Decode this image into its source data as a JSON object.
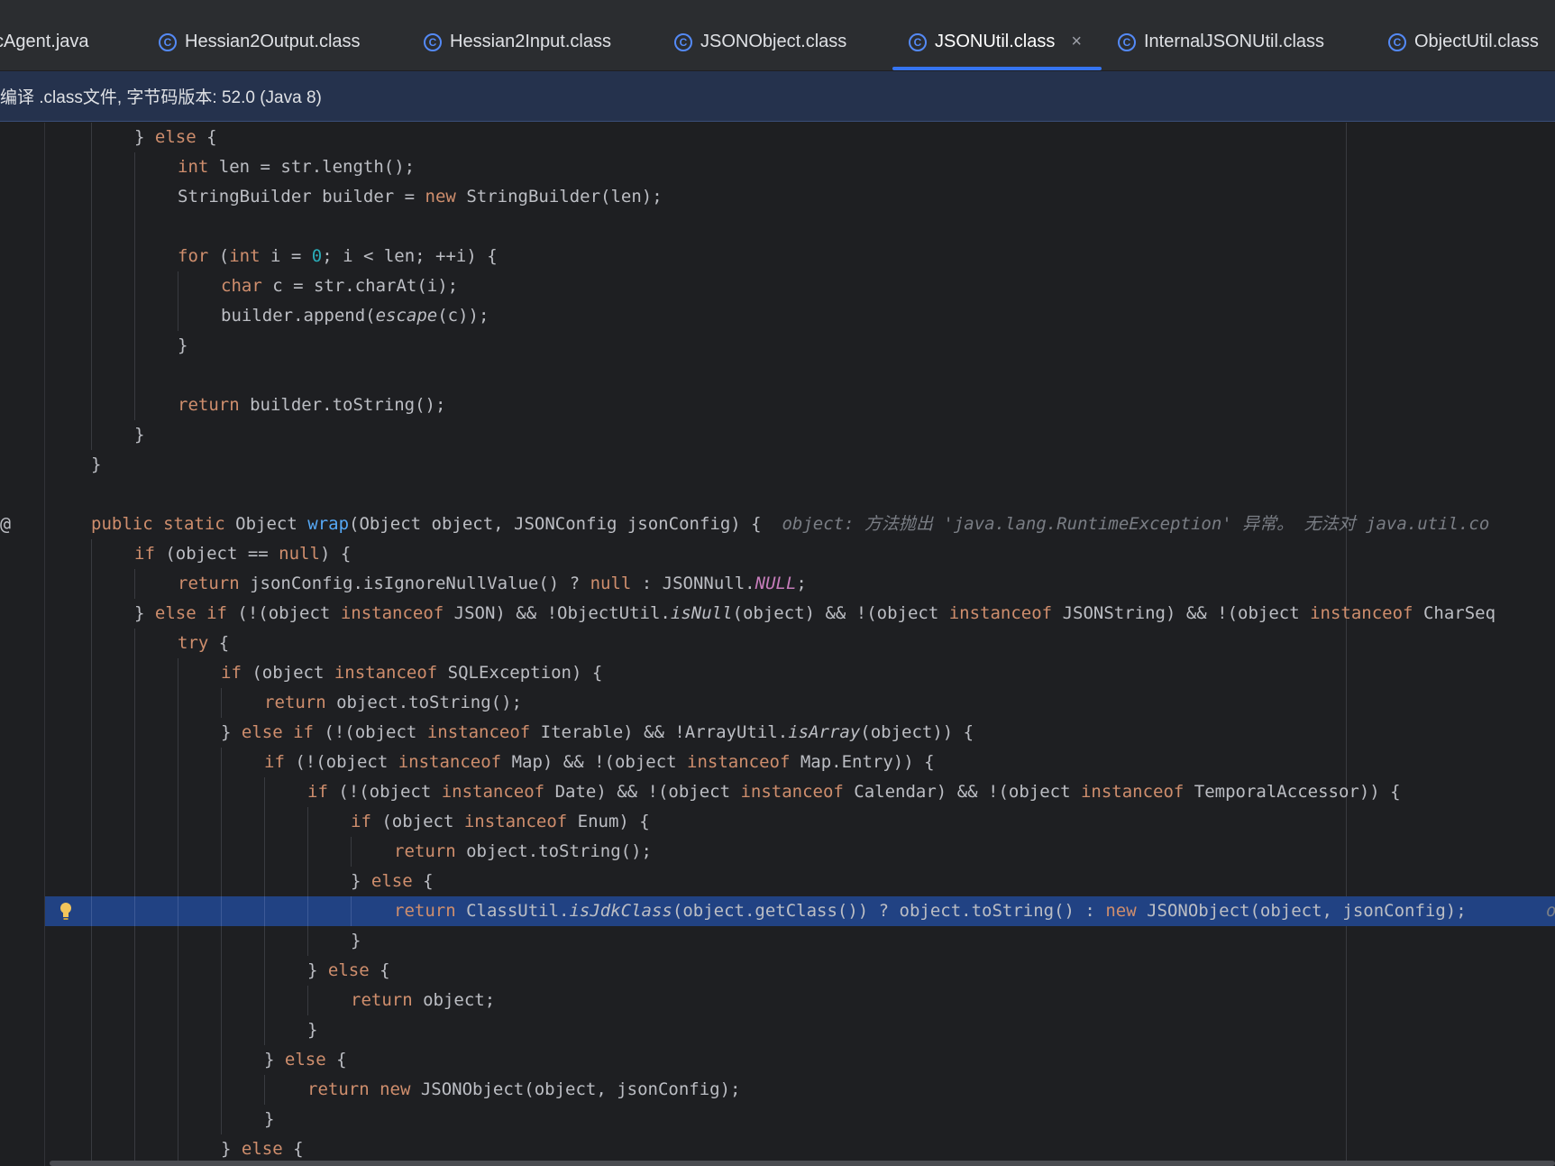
{
  "tabs": [
    {
      "label": "cAgent.java",
      "icon": "java-class-icon"
    },
    {
      "label": "Hessian2Output.class",
      "icon": "class-icon"
    },
    {
      "label": "Hessian2Input.class",
      "icon": "class-icon"
    },
    {
      "label": "JSONObject.class",
      "icon": "class-icon"
    },
    {
      "label": "JSONUtil.class",
      "icon": "class-icon",
      "active": true,
      "close": "×"
    },
    {
      "label": "InternalJSONUtil.class",
      "icon": "class-icon"
    },
    {
      "label": "ObjectUtil.class",
      "icon": "class-icon"
    }
  ],
  "banner": {
    "text": "编译 .class文件, 字节码版本: 52.0 (Java 8)"
  },
  "gutter": {
    "at_symbol": "@"
  },
  "hint": {
    "text": "object: 方法抛出 'java.lang.RuntimeException' 异常。 无法对 java.util.co"
  },
  "highlight_tail": "o",
  "colors": {
    "keyword": "#cf8e6d",
    "function": "#56a8f5",
    "number": "#2aacb8",
    "constant": "#c77dbb",
    "highlight": "#214283",
    "accent": "#3574f0"
  },
  "code_lines": [
    [
      [
        "} "
      ],
      [
        "else",
        "kw"
      ],
      [
        " {"
      ]
    ],
    [
      [
        "int",
        "kw"
      ],
      [
        " len = str.length();"
      ]
    ],
    [
      [
        "StringBuilder builder = "
      ],
      [
        "new",
        "kw"
      ],
      [
        " StringBuilder(len);"
      ]
    ],
    [],
    [
      [
        "for",
        "kw"
      ],
      [
        " ("
      ],
      [
        "int",
        "kw"
      ],
      [
        " i = "
      ],
      [
        "0",
        "num"
      ],
      [
        "; i < len; ++i) {"
      ]
    ],
    [
      [
        "char",
        "kw"
      ],
      [
        " c = str.charAt(i);"
      ]
    ],
    [
      [
        "builder.append("
      ],
      [
        "escape",
        "it"
      ],
      [
        "(c));"
      ]
    ],
    [
      [
        "}"
      ]
    ],
    [],
    [
      [
        "return",
        "kw"
      ],
      [
        " builder.toString();"
      ]
    ],
    [
      [
        "}"
      ]
    ],
    [
      [
        "}"
      ]
    ],
    [],
    [
      [
        "public",
        "kw"
      ],
      [
        " "
      ],
      [
        "static",
        "kw"
      ],
      [
        " Object "
      ],
      [
        "wrap",
        "fn"
      ],
      [
        "(Object object, JSONConfig jsonConfig) {  "
      ]
    ],
    [
      [
        "if",
        "kw"
      ],
      [
        " (object == "
      ],
      [
        "null",
        "kw"
      ],
      [
        ") {"
      ]
    ],
    [
      [
        "return",
        "kw"
      ],
      [
        " jsonConfig.isIgnoreNullValue() ? "
      ],
      [
        "null",
        "kw"
      ],
      [
        " : JSONNull."
      ],
      [
        "NULL",
        "const"
      ],
      [
        ";"
      ]
    ],
    [
      [
        "} "
      ],
      [
        "else if",
        "kw"
      ],
      [
        " (!(object "
      ],
      [
        "instanceof",
        "kw"
      ],
      [
        " JSON) && !ObjectUtil."
      ],
      [
        "isNull",
        "it"
      ],
      [
        "(object) && !(object "
      ],
      [
        "instanceof",
        "kw"
      ],
      [
        " JSONString) && !(object "
      ],
      [
        "instanceof",
        "kw"
      ],
      [
        " CharSeq"
      ]
    ],
    [
      [
        "try",
        "kw"
      ],
      [
        " {"
      ]
    ],
    [
      [
        "if",
        "kw"
      ],
      [
        " (object "
      ],
      [
        "instanceof",
        "kw"
      ],
      [
        " SQLException) {"
      ]
    ],
    [
      [
        "return",
        "kw"
      ],
      [
        " object.toString();"
      ]
    ],
    [
      [
        "} "
      ],
      [
        "else if",
        "kw"
      ],
      [
        " (!(object "
      ],
      [
        "instanceof",
        "kw"
      ],
      [
        " Iterable) && !ArrayUtil."
      ],
      [
        "isArray",
        "it"
      ],
      [
        "(object)) {"
      ]
    ],
    [
      [
        "if",
        "kw"
      ],
      [
        " (!(object "
      ],
      [
        "instanceof",
        "kw"
      ],
      [
        " Map) && !(object "
      ],
      [
        "instanceof",
        "kw"
      ],
      [
        " Map.Entry)) {"
      ]
    ],
    [
      [
        "if",
        "kw"
      ],
      [
        " (!(object "
      ],
      [
        "instanceof",
        "kw"
      ],
      [
        " Date) && !(object "
      ],
      [
        "instanceof",
        "kw"
      ],
      [
        " Calendar) && !(object "
      ],
      [
        "instanceof",
        "kw"
      ],
      [
        " TemporalAccessor)) {"
      ]
    ],
    [
      [
        "if",
        "kw"
      ],
      [
        " (object "
      ],
      [
        "instanceof",
        "kw"
      ],
      [
        " Enum) {"
      ]
    ],
    [
      [
        "return",
        "kw"
      ],
      [
        " object.toString();"
      ]
    ],
    [
      [
        "} "
      ],
      [
        "else",
        "kw"
      ],
      [
        " {"
      ]
    ],
    [
      [
        "return",
        "kw"
      ],
      [
        " ClassUtil."
      ],
      [
        "isJdkClass",
        "it"
      ],
      [
        "(object.getClass()) ? object.toString() : "
      ],
      [
        "new",
        "kw"
      ],
      [
        " JSONObject(object, jsonConfig);"
      ]
    ],
    [
      [
        "}"
      ]
    ],
    [
      [
        "} "
      ],
      [
        "else",
        "kw"
      ],
      [
        " {"
      ]
    ],
    [
      [
        "return",
        "kw"
      ],
      [
        " object;"
      ]
    ],
    [
      [
        "}"
      ]
    ],
    [
      [
        "} "
      ],
      [
        "else",
        "kw"
      ],
      [
        " {"
      ]
    ],
    [
      [
        "return",
        "kw"
      ],
      [
        " "
      ],
      [
        "new",
        "kw"
      ],
      [
        " JSONObject(object, jsonConfig);"
      ]
    ],
    [
      [
        "}"
      ]
    ],
    [
      [
        "} "
      ],
      [
        "else",
        "kw"
      ],
      [
        " {"
      ]
    ]
  ]
}
